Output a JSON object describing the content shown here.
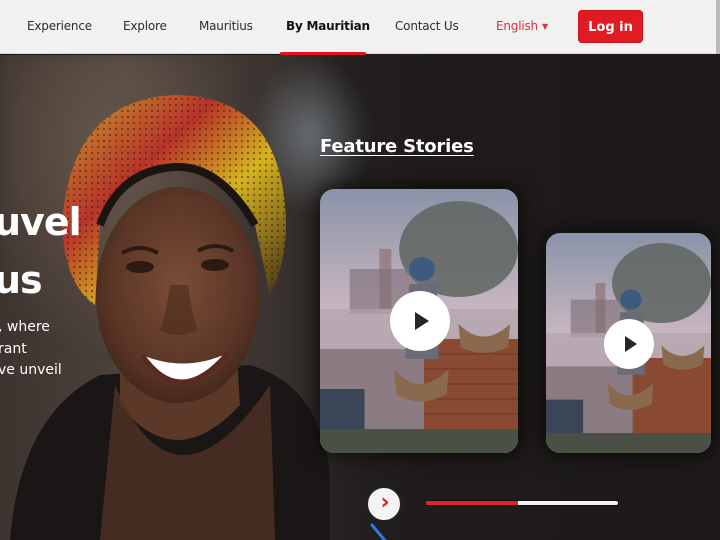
{
  "nav": {
    "items": [
      {
        "label": "Experience",
        "active": false
      },
      {
        "label": "Explore",
        "active": false
      },
      {
        "label": "Mauritius",
        "active": false
      },
      {
        "label": "By Mauritian",
        "active": true
      },
      {
        "label": "Contact Us",
        "active": false
      }
    ],
    "language": {
      "label": "English",
      "icon": "caret-down-icon",
      "caret": "▼"
    },
    "login_label": "Log in"
  },
  "hero": {
    "title_line1": "uvel",
    "title_line2": "us",
    "subtitle_lines": [
      ", where",
      "rant",
      "ve unveil"
    ]
  },
  "feature": {
    "title": "Feature Stories",
    "pagination": {
      "total": 4,
      "active_index": 0
    },
    "cards": [
      {
        "name": "story-card-1",
        "icon": "play-icon"
      },
      {
        "name": "story-card-2",
        "icon": "play-icon"
      }
    ],
    "next_icon": "chevron-right-icon",
    "next_glyph": "›",
    "progress": 0.48
  },
  "colors": {
    "accent": "#e11b22",
    "nav_bg": "#f1f1f1",
    "hero_bg": "#1d1a19",
    "language_color": "#e0303a"
  }
}
